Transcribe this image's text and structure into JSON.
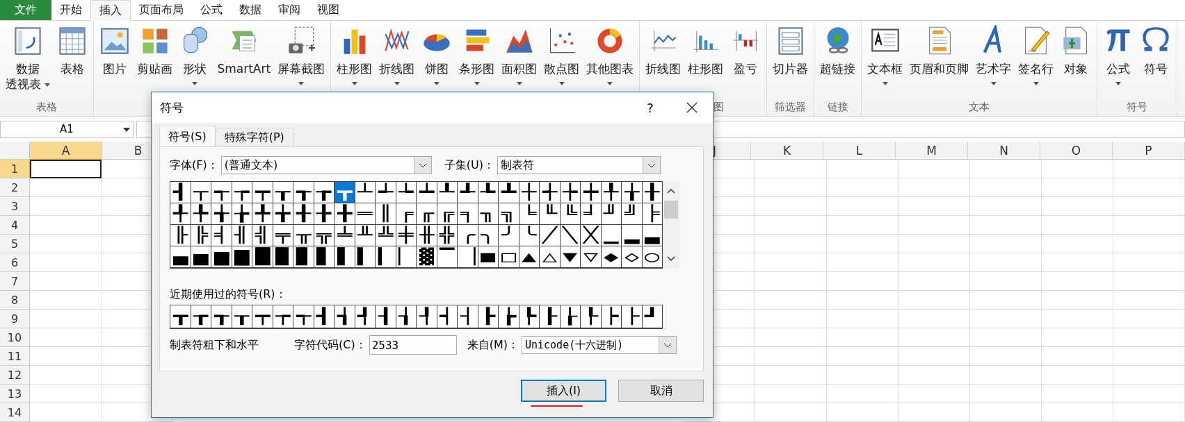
{
  "ribbon_tabs": [
    {
      "label": "文件",
      "kind": "file",
      "selected": false
    },
    {
      "label": "开始",
      "kind": "tab",
      "selected": false
    },
    {
      "label": "插入",
      "kind": "tab",
      "selected": true
    },
    {
      "label": "页面布局",
      "kind": "tab",
      "selected": false
    },
    {
      "label": "公式",
      "kind": "tab",
      "selected": false
    },
    {
      "label": "数据",
      "kind": "tab",
      "selected": false
    },
    {
      "label": "审阅",
      "kind": "tab",
      "selected": false
    },
    {
      "label": "视图",
      "kind": "tab",
      "selected": false
    }
  ],
  "ribbon_groups": [
    {
      "label": "表格",
      "cut": false,
      "items": [
        {
          "kind": "pivot",
          "lines": [
            "数据",
            "透视表"
          ],
          "dropdown": true
        },
        {
          "kind": "table",
          "lines": [
            "表格"
          ],
          "dropdown": false
        }
      ]
    },
    {
      "items": [
        {
          "kind": "picture",
          "lines": [
            "图片"
          ],
          "dropdown": false
        },
        {
          "kind": "clipart",
          "lines": [
            "剪贴画"
          ],
          "dropdown": false
        },
        {
          "kind": "shapes",
          "lines": [
            "形状"
          ],
          "dropdown": true
        },
        {
          "kind": "smartart",
          "lines": [
            "SmartArt"
          ],
          "dropdown": false
        },
        {
          "kind": "screenshot",
          "lines": [
            "屏幕截图"
          ],
          "dropdown": true
        }
      ]
    },
    {
      "items": [
        {
          "kind": "column",
          "lines": [
            "柱形图"
          ],
          "dropdown": true
        },
        {
          "kind": "line",
          "lines": [
            "折线图"
          ],
          "dropdown": true
        },
        {
          "kind": "pie",
          "lines": [
            "饼图"
          ],
          "dropdown": true
        },
        {
          "kind": "bar",
          "lines": [
            "条形图"
          ],
          "dropdown": true
        },
        {
          "kind": "area",
          "lines": [
            "面积图"
          ],
          "dropdown": true
        },
        {
          "kind": "scatter",
          "lines": [
            "散点图"
          ],
          "dropdown": true
        },
        {
          "kind": "other",
          "lines": [
            "其他图表"
          ],
          "dropdown": true
        }
      ]
    },
    {
      "label": "图",
      "cut": true,
      "items": [
        {
          "kind": "sparkline",
          "lines": [
            "折线图"
          ],
          "dropdown": false
        },
        {
          "kind": "sparkcolumn",
          "lines": [
            "柱形图"
          ],
          "dropdown": false
        },
        {
          "kind": "winloss",
          "lines": [
            "盈亏"
          ],
          "dropdown": false
        }
      ]
    },
    {
      "label": "筛选器",
      "cut": false,
      "items": [
        {
          "kind": "slicer",
          "lines": [
            "切片器"
          ],
          "dropdown": false
        }
      ]
    },
    {
      "label": "链接",
      "cut": false,
      "items": [
        {
          "kind": "hyperlink",
          "lines": [
            "超链接"
          ],
          "dropdown": false
        }
      ]
    },
    {
      "label": "文本",
      "cut": false,
      "items": [
        {
          "kind": "textbox",
          "lines": [
            "文本框"
          ],
          "dropdown": true
        },
        {
          "kind": "header",
          "lines": [
            "页眉和页脚"
          ],
          "dropdown": false
        },
        {
          "kind": "wordart",
          "lines": [
            "艺术字"
          ],
          "dropdown": true
        },
        {
          "kind": "signature",
          "lines": [
            "签名行"
          ],
          "dropdown": true
        },
        {
          "kind": "object",
          "lines": [
            "对象"
          ],
          "dropdown": false
        }
      ]
    },
    {
      "label": "符号",
      "cut": false,
      "items": [
        {
          "kind": "equation",
          "lines": [
            "公式"
          ],
          "dropdown": true
        },
        {
          "kind": "symbol",
          "lines": [
            "符号"
          ],
          "dropdown": false
        }
      ]
    }
  ],
  "name_box": "A1",
  "columns_left": [
    {
      "label": "A",
      "selected": true
    },
    {
      "label": "B",
      "selected": false
    }
  ],
  "columns_right": [
    {
      "label": "J",
      "selected": false
    },
    {
      "label": "K",
      "selected": false
    },
    {
      "label": "L",
      "selected": false
    },
    {
      "label": "M",
      "selected": false
    },
    {
      "label": "N",
      "selected": false
    },
    {
      "label": "O",
      "selected": false
    },
    {
      "label": "P",
      "selected": false
    }
  ],
  "rows": [
    {
      "label": "1",
      "selected": true
    },
    {
      "label": "2",
      "selected": false
    },
    {
      "label": "3",
      "selected": false
    },
    {
      "label": "4",
      "selected": false
    },
    {
      "label": "5",
      "selected": false
    },
    {
      "label": "6",
      "selected": false
    },
    {
      "label": "7",
      "selected": false
    },
    {
      "label": "8",
      "selected": false
    },
    {
      "label": "9",
      "selected": false
    },
    {
      "label": "10",
      "selected": false
    },
    {
      "label": "11",
      "selected": false
    },
    {
      "label": "12",
      "selected": false
    },
    {
      "label": "13",
      "selected": false
    },
    {
      "label": "14",
      "selected": false
    }
  ],
  "dialog": {
    "title": "符号",
    "help": "?",
    "tabs": [
      {
        "label": "符号(S)",
        "selected": true
      },
      {
        "label": "特殊字符(P)",
        "selected": false
      }
    ],
    "font_label": "字体(F)：",
    "font_value": "(普通文本)",
    "subset_label": "子集(U)：",
    "subset_value": "制表符",
    "symbols": [
      [
        {
          "c": "┫",
          "selected": false
        },
        {
          "c": "┬",
          "selected": false
        },
        {
          "c": "┭",
          "selected": false
        },
        {
          "c": "┮",
          "selected": false
        },
        {
          "c": "┯",
          "selected": false
        },
        {
          "c": "┰",
          "selected": false
        },
        {
          "c": "┱",
          "selected": false
        },
        {
          "c": "┲",
          "selected": false
        },
        {
          "c": "┳",
          "selected": true
        },
        {
          "c": "┴",
          "selected": false
        },
        {
          "c": "┵",
          "selected": false
        },
        {
          "c": "┶",
          "selected": false
        },
        {
          "c": "┷",
          "selected": false
        },
        {
          "c": "┸",
          "selected": false
        },
        {
          "c": "┹",
          "selected": false
        },
        {
          "c": "┺",
          "selected": false
        },
        {
          "c": "┻",
          "selected": false
        },
        {
          "c": "┼",
          "selected": false
        },
        {
          "c": "┽",
          "selected": false
        },
        {
          "c": "┾",
          "selected": false
        },
        {
          "c": "┿",
          "selected": false
        },
        {
          "c": "╀",
          "selected": false
        },
        {
          "c": "╁",
          "selected": false
        },
        {
          "c": "╂",
          "selected": false
        }
      ],
      [
        {
          "c": "╃",
          "selected": false
        },
        {
          "c": "╄",
          "selected": false
        },
        {
          "c": "╅",
          "selected": false
        },
        {
          "c": "╆",
          "selected": false
        },
        {
          "c": "╇",
          "selected": false
        },
        {
          "c": "╈",
          "selected": false
        },
        {
          "c": "╉",
          "selected": false
        },
        {
          "c": "╊",
          "selected": false
        },
        {
          "c": "╋",
          "selected": false
        },
        {
          "c": "═",
          "selected": false
        },
        {
          "c": "║",
          "selected": false
        },
        {
          "c": "╒",
          "selected": false
        },
        {
          "c": "╓",
          "selected": false
        },
        {
          "c": "╔",
          "selected": false
        },
        {
          "c": "╕",
          "selected": false
        },
        {
          "c": "╖",
          "selected": false
        },
        {
          "c": "╗",
          "selected": false
        },
        {
          "c": "╘",
          "selected": false
        },
        {
          "c": "╙",
          "selected": false
        },
        {
          "c": "╚",
          "selected": false
        },
        {
          "c": "╛",
          "selected": false
        },
        {
          "c": "╜",
          "selected": false
        },
        {
          "c": "╝",
          "selected": false
        },
        {
          "c": "╞",
          "selected": false
        }
      ],
      [
        {
          "c": "╟",
          "selected": false
        },
        {
          "c": "╠",
          "selected": false
        },
        {
          "c": "╡",
          "selected": false
        },
        {
          "c": "╢",
          "selected": false
        },
        {
          "c": "╣",
          "selected": false
        },
        {
          "c": "╤",
          "selected": false
        },
        {
          "c": "╥",
          "selected": false
        },
        {
          "c": "╦",
          "selected": false
        },
        {
          "c": "╧",
          "selected": false
        },
        {
          "c": "╨",
          "selected": false
        },
        {
          "c": "╩",
          "selected": false
        },
        {
          "c": "╪",
          "selected": false
        },
        {
          "c": "╫",
          "selected": false
        },
        {
          "c": "╬",
          "selected": false
        },
        {
          "c": "╭",
          "selected": false
        },
        {
          "c": "╮",
          "selected": false
        },
        {
          "c": "╯",
          "selected": false
        },
        {
          "c": "╰",
          "selected": false
        },
        {
          "c": "╱",
          "selected": false
        },
        {
          "c": "╲",
          "selected": false
        },
        {
          "c": "╳",
          "selected": false
        },
        {
          "c": "▁",
          "selected": false
        },
        {
          "c": "▂",
          "selected": false
        },
        {
          "c": "▃",
          "selected": false
        }
      ],
      [
        {
          "c": "▄",
          "selected": false
        },
        {
          "c": "▅",
          "selected": false
        },
        {
          "c": "▆",
          "selected": false
        },
        {
          "c": "▇",
          "selected": false
        },
        {
          "c": "█",
          "selected": false
        },
        {
          "c": "▉",
          "selected": false
        },
        {
          "c": "▊",
          "selected": false
        },
        {
          "c": "▋",
          "selected": false
        },
        {
          "c": "▌",
          "selected": false
        },
        {
          "c": "▍",
          "selected": false
        },
        {
          "c": "▎",
          "selected": false
        },
        {
          "c": "▏",
          "selected": false
        },
        {
          "c": "▓",
          "selected": false
        },
        {
          "c": "▔",
          "selected": false
        },
        {
          "c": "▕",
          "selected": false
        },
        {
          "c": "■",
          "selected": false
        },
        {
          "c": "□",
          "selected": false
        },
        {
          "c": "▲",
          "selected": false
        },
        {
          "c": "△",
          "selected": false
        },
        {
          "c": "▼",
          "selected": false
        },
        {
          "c": "▽",
          "selected": false
        },
        {
          "c": "◆",
          "selected": false
        },
        {
          "c": "◇",
          "selected": false
        },
        {
          "c": "○",
          "selected": false
        }
      ]
    ],
    "recent_label": "近期使用过的符号(R)：",
    "recent": [
      "┳",
      "┲",
      "┱",
      "┰",
      "┯",
      "┮",
      "┭",
      "┫",
      "┪",
      "┩",
      "┨",
      "┧",
      "┦",
      "┥",
      "┤",
      "┣",
      "┢",
      "┡",
      "┠",
      "┟",
      "┞",
      "┝",
      "├",
      "┛"
    ],
    "char_name": "制表符粗下和水平",
    "code_label": "字符代码(C)：",
    "code_value": "2533",
    "from_label": "来自(M)：",
    "from_value": "Unicode(十六进制)",
    "buttons": [
      {
        "label": "插入(I)",
        "default": true,
        "marked": true
      },
      {
        "label": "取消",
        "default": false,
        "marked": false
      }
    ]
  }
}
